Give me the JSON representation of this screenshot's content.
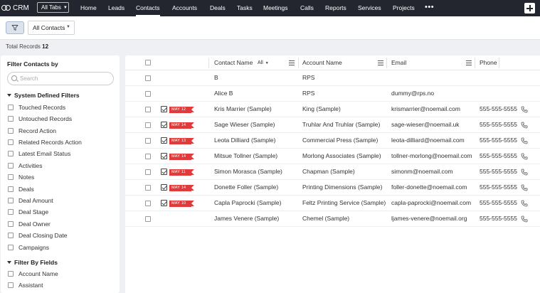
{
  "brand": {
    "name": "CRM"
  },
  "top_nav": {
    "all_tabs_label": "All Tabs",
    "tabs": [
      {
        "label": "Home",
        "active": false
      },
      {
        "label": "Leads",
        "active": false
      },
      {
        "label": "Contacts",
        "active": true
      },
      {
        "label": "Accounts",
        "active": false
      },
      {
        "label": "Deals",
        "active": false
      },
      {
        "label": "Tasks",
        "active": false
      },
      {
        "label": "Meetings",
        "active": false
      },
      {
        "label": "Calls",
        "active": false
      },
      {
        "label": "Reports",
        "active": false
      },
      {
        "label": "Services",
        "active": false
      },
      {
        "label": "Projects",
        "active": false
      }
    ],
    "more_label": "•••"
  },
  "toolbar": {
    "view_label": "All Contacts"
  },
  "summary": {
    "total_label": "Total Records",
    "total_count": "12"
  },
  "filter_panel": {
    "title": "Filter Contacts by",
    "search_placeholder": "Search",
    "system_section_label": "System Defined Filters",
    "system_filters": [
      "Touched Records",
      "Untouched Records",
      "Record Action",
      "Related Records Action",
      "Latest Email Status",
      "Activities",
      "Notes",
      "Deals",
      "Deal Amount",
      "Deal Stage",
      "Deal Owner",
      "Deal Closing Date",
      "Campaigns"
    ],
    "fields_section_label": "Filter By Fields",
    "field_filters": [
      "Account Name",
      "Assistant"
    ]
  },
  "table": {
    "columns": {
      "contact_name": "Contact Name",
      "contact_filter": "All",
      "account_name": "Account Name",
      "email": "Email",
      "phone": "Phone"
    },
    "rows": [
      {
        "date_flag": "",
        "contact_name": "B",
        "account_name": "RPS",
        "email": "",
        "phone": ""
      },
      {
        "date_flag": "",
        "contact_name": "Alice B",
        "account_name": "RPS",
        "email": "dummy@rps.no",
        "phone": ""
      },
      {
        "date_flag": "MAY 12",
        "contact_name": "Kris Marrier (Sample)",
        "account_name": "King (Sample)",
        "email": "krismarrier@noemail.com",
        "phone": "555-555-5555"
      },
      {
        "date_flag": "MAY 14",
        "contact_name": "Sage Wieser (Sample)",
        "account_name": "Truhlar And Truhlar (Sample)",
        "email": "sage-wieser@noemail.uk",
        "phone": "555-555-5555"
      },
      {
        "date_flag": "MAY 13",
        "contact_name": "Leota Dilliard (Sample)",
        "account_name": "Commercial Press (Sample)",
        "email": "leota-dilliard@noemail.com",
        "phone": "555-555-5555"
      },
      {
        "date_flag": "MAY 14",
        "contact_name": "Mitsue Tollner (Sample)",
        "account_name": "Morlong Associates (Sample)",
        "email": "tollner-morlong@noemail.com",
        "phone": "555-555-5555"
      },
      {
        "date_flag": "MAY 11",
        "contact_name": "Simon Morasca (Sample)",
        "account_name": "Chapman (Sample)",
        "email": "simonm@noemail.com",
        "phone": "555-555-5555"
      },
      {
        "date_flag": "MAY 14",
        "contact_name": "Donette Foller (Sample)",
        "account_name": "Printing Dimensions (Sample)",
        "email": "foller-donette@noemail.com",
        "phone": "555-555-5555"
      },
      {
        "date_flag": "MAY 10",
        "contact_name": "Capla Paprocki (Sample)",
        "account_name": "Feltz Printing Service (Sample)",
        "email": "capla-paprocki@noemail.com",
        "phone": "555-555-5555"
      },
      {
        "date_flag": "",
        "contact_name": "James Venere (Sample)",
        "account_name": "Chemel (Sample)",
        "email": "ljames-venere@noemail.org",
        "phone": "555-555-5555"
      }
    ]
  },
  "colors": {
    "topbar_bg": "#23262f",
    "date_flag": "#e03a3a",
    "page_bg": "#eef0f3",
    "filter_toggle_bg": "#dce3ec"
  }
}
